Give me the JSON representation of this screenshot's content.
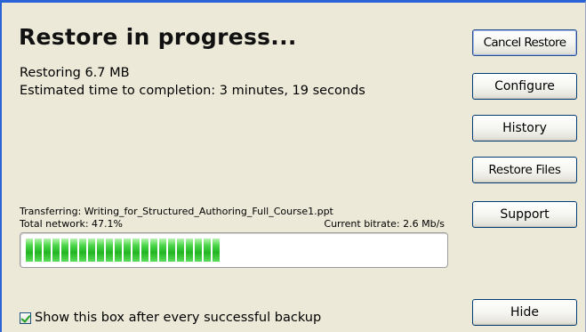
{
  "dialog": {
    "title": "Restore in progress...",
    "status_line_1": "Restoring 6.7 MB",
    "status_line_2": "Estimated time to completion: 3 minutes, 19 seconds"
  },
  "transfer": {
    "file_label": "Transferring: Writing_for_Structured_Authoring_Full_Course1.ppt",
    "network_label": "Total network: 47.1%",
    "bitrate_label": "Current bitrate: 2.6 Mb/s",
    "progress_fraction": 0.471,
    "progress_color": "#22b522"
  },
  "buttons": {
    "cancel_restore": "Cancel Restore",
    "configure": "Configure",
    "history": "History",
    "restore_files": "Restore Files",
    "support": "Support",
    "hide": "Hide"
  },
  "show_after_backup": {
    "label": "Show this box after every successful backup",
    "checked": true
  },
  "colors": {
    "window_background": "#ece9d8",
    "window_border": "#2a63d6",
    "checkmark": "#21a121"
  }
}
